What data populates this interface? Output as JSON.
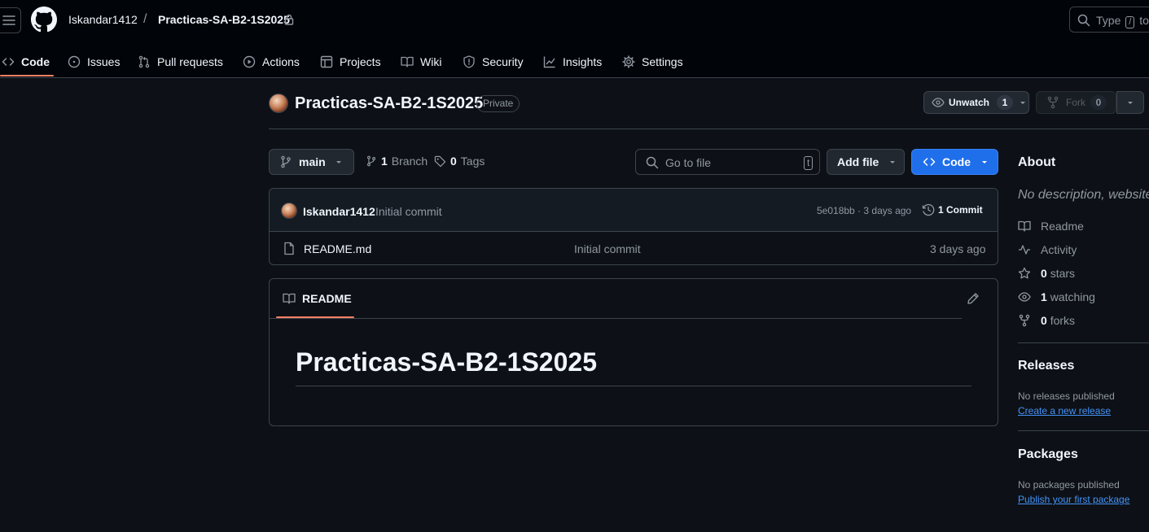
{
  "header": {
    "owner": "Iskandar1412",
    "separator": "/",
    "repo_name": "Practicas-SA-B2-1S2025",
    "search_prefix": "Type",
    "search_key": "/",
    "search_suffix": "to"
  },
  "nav_tabs": [
    {
      "label": "Code",
      "icon": "code-icon",
      "active": true
    },
    {
      "label": "Issues",
      "icon": "issue-icon"
    },
    {
      "label": "Pull requests",
      "icon": "pull-request-icon"
    },
    {
      "label": "Actions",
      "icon": "play-icon"
    },
    {
      "label": "Projects",
      "icon": "table-icon"
    },
    {
      "label": "Wiki",
      "icon": "book-icon"
    },
    {
      "label": "Security",
      "icon": "shield-icon"
    },
    {
      "label": "Insights",
      "icon": "graph-icon"
    },
    {
      "label": "Settings",
      "icon": "gear-icon"
    }
  ],
  "repo": {
    "title": "Practicas-SA-B2-1S2025",
    "visibility": "Private",
    "unwatch_label": "Unwatch",
    "watch_count": "1",
    "fork_label": "Fork",
    "fork_count": "0"
  },
  "toolbar": {
    "branch": "main",
    "branch_count": "1",
    "branch_label": "Branch",
    "tag_count": "0",
    "tag_label": "Tags",
    "go_to_file_placeholder": "Go to file",
    "go_to_file_key": "t",
    "add_file_label": "Add file",
    "code_label": "Code"
  },
  "latest_commit": {
    "author": "Iskandar1412",
    "message": "Initial commit",
    "sha_and_time": "5e018bb · 3 days ago",
    "commit_count": "1 Commit"
  },
  "files": [
    {
      "name": "README.md",
      "message": "Initial commit",
      "time": "3 days ago"
    }
  ],
  "readme": {
    "tab_label": "README",
    "heading": "Practicas-SA-B2-1S2025"
  },
  "about": {
    "heading": "About",
    "description": "No description, website,",
    "items": [
      {
        "icon": "book-icon",
        "count": "",
        "label": "Readme"
      },
      {
        "icon": "pulse-icon",
        "count": "",
        "label": "Activity"
      },
      {
        "icon": "star-icon",
        "count": "0",
        "label": "stars"
      },
      {
        "icon": "eye-icon",
        "count": "1",
        "label": "watching"
      },
      {
        "icon": "fork-icon",
        "count": "0",
        "label": "forks"
      }
    ]
  },
  "releases": {
    "heading": "Releases",
    "empty_text": "No releases published",
    "link": "Create a new release"
  },
  "packages": {
    "heading": "Packages",
    "empty_text": "No packages published",
    "link": "Publish your first package"
  },
  "colors": {
    "background": "#0d1117",
    "header_bg": "#010409",
    "border": "#3d444d",
    "accent_underline": "#f78166",
    "primary_button": "#1f6feb",
    "link": "#4493f8"
  }
}
